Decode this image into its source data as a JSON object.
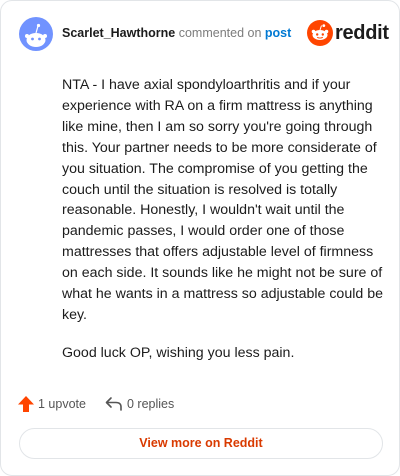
{
  "header": {
    "username": "Scarlet_Hawthorne",
    "action_text": "commented on",
    "post_link": "post",
    "brand_word": "reddit"
  },
  "comment": {
    "paragraphs": [
      "NTA - I have axial spondyloarthritis and if your experience with RA on a firm mattress is anything like mine, then I am so sorry you're going through this. Your partner needs to be more considerate of you situation. The compromise of you getting the couch until the situation is resolved is totally reasonable. Honestly, I wouldn't wait until the pandemic passes, I would order one of those mattresses that offers adjustable level of firmness on each side. It sounds like he might not be sure of what he wants in a mattress so adjustable could be key.",
      "Good luck OP, wishing you less pain."
    ]
  },
  "footer": {
    "upvote_label": "1 upvote",
    "replies_label": "0 replies"
  },
  "view_more_label": "View more on Reddit",
  "colors": {
    "brand_orange": "#ff4500",
    "upvote_orange": "#ff4500",
    "link_blue": "#0079d3",
    "view_more_text": "#d93a00",
    "avatar_blue": "#7193ff"
  },
  "icons": {
    "avatar": "snoo-avatar-icon",
    "brand": "reddit-logo-icon",
    "upvote": "upvote-arrow-icon",
    "reply": "reply-arrow-icon"
  }
}
